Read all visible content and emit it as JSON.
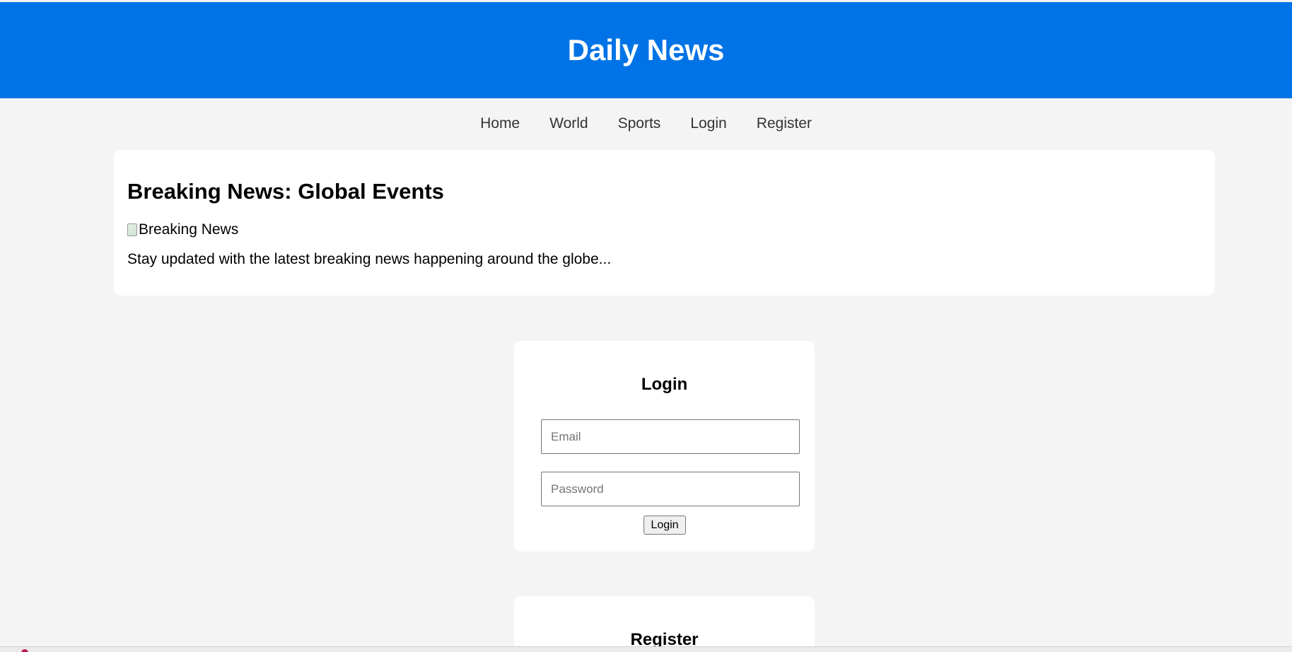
{
  "header": {
    "title": "Daily News"
  },
  "nav": {
    "items": [
      {
        "label": "Home"
      },
      {
        "label": "World"
      },
      {
        "label": "Sports"
      },
      {
        "label": "Login"
      },
      {
        "label": "Register"
      }
    ]
  },
  "article": {
    "title": "Breaking News: Global Events",
    "image_alt": "Breaking News",
    "summary": "Stay updated with the latest breaking news happening around the globe..."
  },
  "login_form": {
    "title": "Login",
    "email_placeholder": "Email",
    "email_value": "",
    "password_placeholder": "Password",
    "password_value": "",
    "submit_label": "Login"
  },
  "register_form": {
    "title": "Register"
  },
  "colors": {
    "header_bg": "#0073e6",
    "page_bg": "#f4f4f4",
    "card_bg": "#ffffff"
  }
}
